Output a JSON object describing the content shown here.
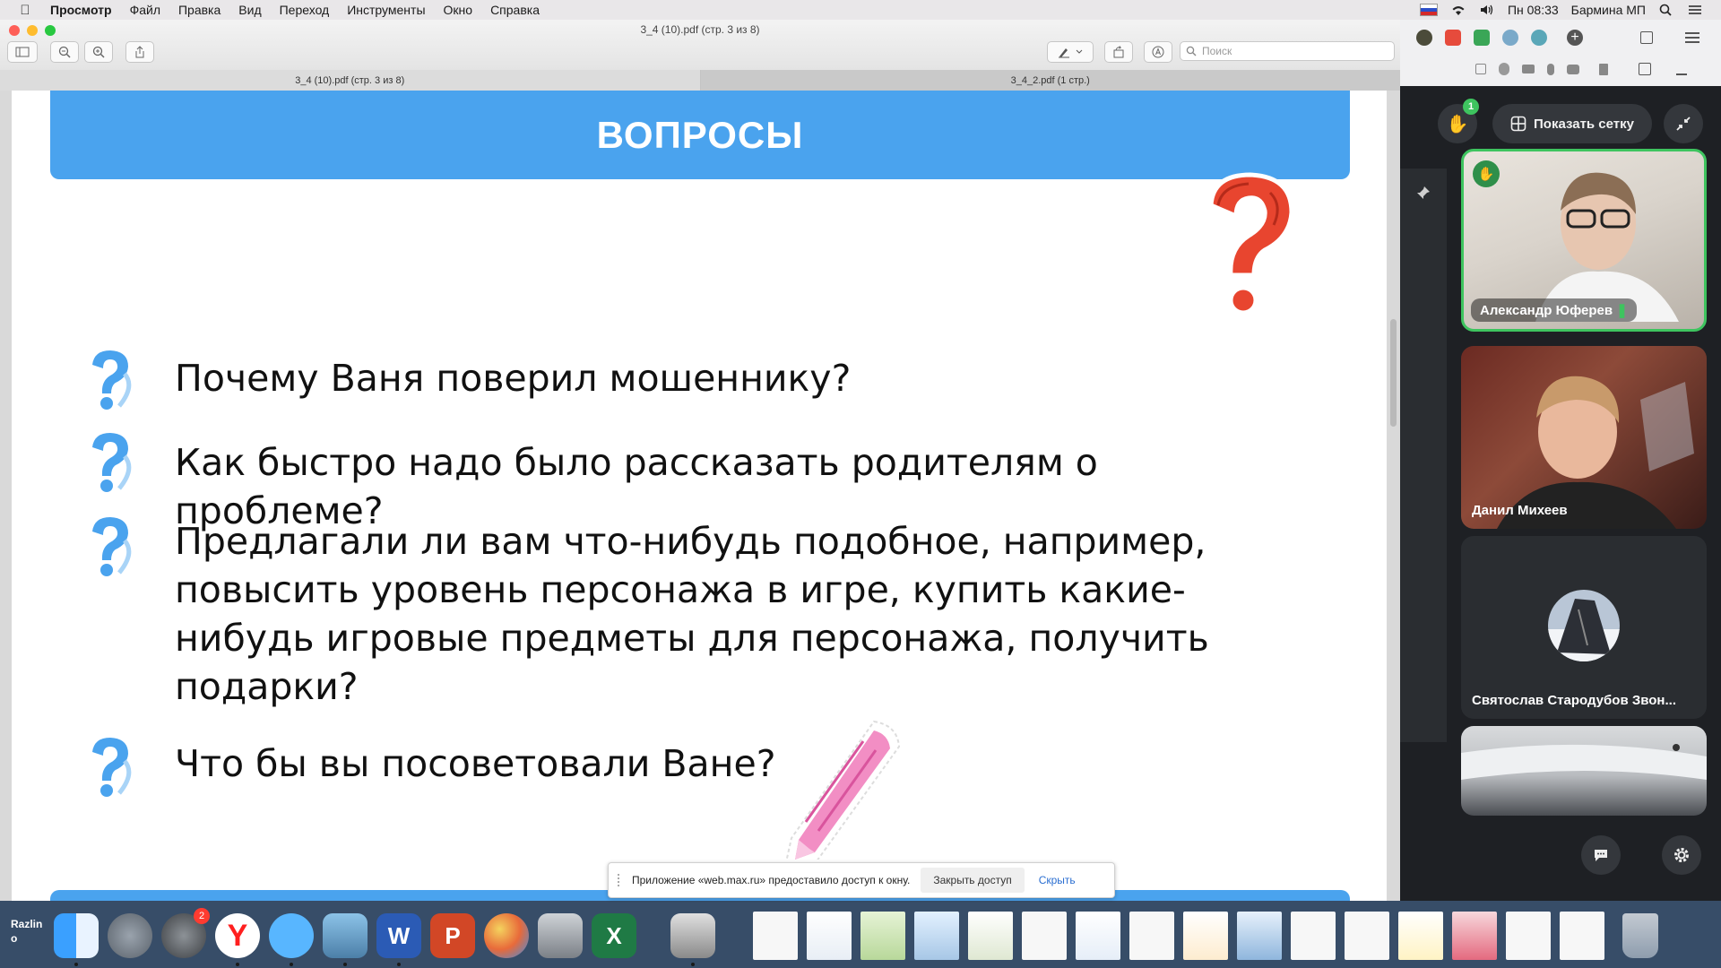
{
  "menubar": {
    "app_name": "Просмотр",
    "items": [
      "Файл",
      "Правка",
      "Вид",
      "Переход",
      "Инструменты",
      "Окно",
      "Справка"
    ],
    "clock": "Пн 08:33",
    "user": "Бармина МП"
  },
  "preview": {
    "window_title": "3_4 (10).pdf (стр. 3 из 8)",
    "search_placeholder": "Поиск",
    "tabs": [
      "3_4 (10).pdf (стр. 3 из 8)",
      "3_4_2.pdf (1 стр.)"
    ]
  },
  "slide": {
    "heading": "ВОПРОСЫ",
    "questions": [
      "Почему Ваня поверил мошеннику?",
      "Как быстро надо было рассказать родителям о проблеме?",
      "Предлагали ли вам что-нибудь подобное, например, повысить уровень персонажа в игре, купить какие-нибудь игровые предметы для персонажа, получить подарки?",
      "Что бы вы посоветовали Ване?"
    ]
  },
  "share_bar": {
    "message": "Приложение «web.max.ru» предоставило доступ к окну.",
    "stop_label": "Закрыть доступ",
    "hide_label": "Скрыть"
  },
  "meeting": {
    "hand_badge": "1",
    "grid_button": "Показать сетку",
    "participants": [
      {
        "name": "Александр Юферев"
      },
      {
        "name": "Данил Михеев"
      },
      {
        "name": "Святослав Стародубов Звон..."
      }
    ]
  },
  "dock": {
    "left_label": "Razlin\nо",
    "settings_badge": "2"
  },
  "colors": {
    "banner_blue": "#4aa3ee",
    "question_mark_blue": "#4aa3ee",
    "active_speaker_green": "#3ec45f"
  }
}
